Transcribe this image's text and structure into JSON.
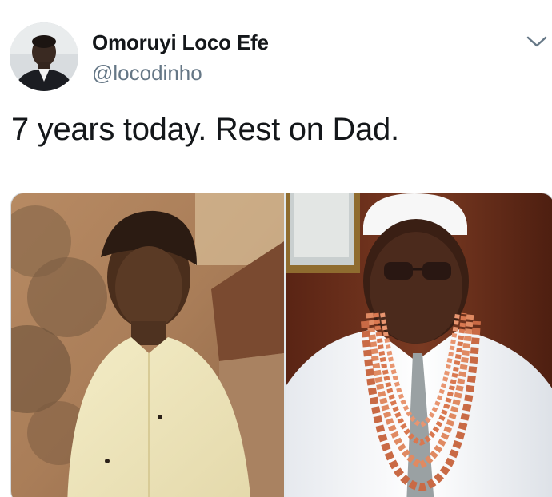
{
  "author": {
    "display_name": "Omoruyi Loco Efe",
    "handle": "@locodinho"
  },
  "tweet": {
    "text": "7 years today. Rest on Dad."
  },
  "icons": {
    "menu": "chevron-down-icon"
  },
  "colors": {
    "primary_text": "#14171a",
    "secondary_text": "#657786",
    "background": "#ffffff"
  }
}
